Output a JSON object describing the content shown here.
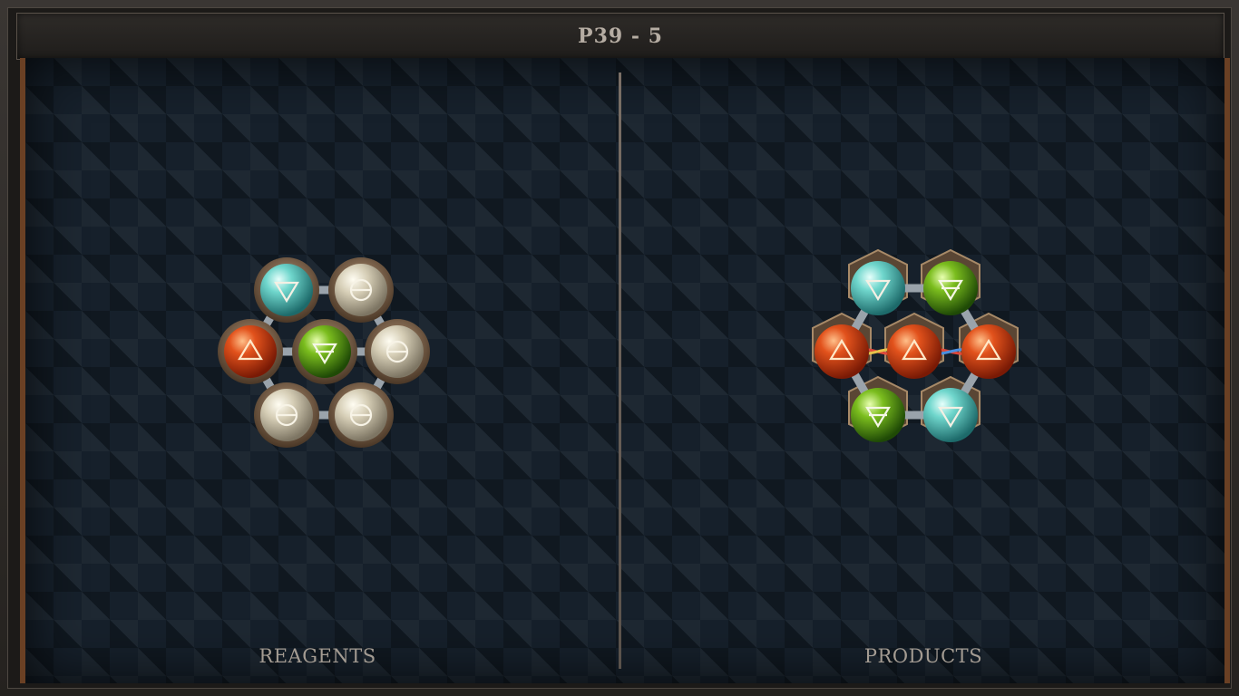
{
  "title": "P39 - 5",
  "panels": {
    "reagents_label": "REAGENTS",
    "products_label": "PRODUCTS"
  },
  "colors": {
    "water": "#4fc9c0",
    "fire": "#d8441a",
    "earth": "#6fae1c",
    "salt": "#d6cfb8",
    "bronze": "#8c7254",
    "frame_accent": "#6a4024"
  },
  "reagent_molecule": {
    "atoms": [
      {
        "id": "a1",
        "element": "water",
        "icon": "water-symbol-icon"
      },
      {
        "id": "a2",
        "element": "salt",
        "icon": "salt-symbol-icon"
      },
      {
        "id": "a3",
        "element": "fire",
        "icon": "fire-symbol-icon"
      },
      {
        "id": "a4",
        "element": "earth",
        "icon": "earth-symbol-icon"
      },
      {
        "id": "a5",
        "element": "salt",
        "icon": "salt-symbol-icon"
      },
      {
        "id": "a6",
        "element": "salt",
        "icon": "salt-symbol-icon"
      },
      {
        "id": "a7",
        "element": "salt",
        "icon": "salt-symbol-icon"
      }
    ]
  },
  "product_molecule": {
    "atoms": [
      {
        "id": "b1",
        "element": "water",
        "icon": "water-symbol-icon"
      },
      {
        "id": "b2",
        "element": "earth",
        "icon": "earth-symbol-icon"
      },
      {
        "id": "b3",
        "element": "fire",
        "icon": "fire-symbol-icon"
      },
      {
        "id": "b4",
        "element": "fire",
        "icon": "fire-symbol-icon"
      },
      {
        "id": "b5",
        "element": "fire",
        "icon": "fire-symbol-icon"
      },
      {
        "id": "b6",
        "element": "earth",
        "icon": "earth-symbol-icon"
      },
      {
        "id": "b7",
        "element": "water",
        "icon": "water-symbol-icon"
      }
    ]
  }
}
